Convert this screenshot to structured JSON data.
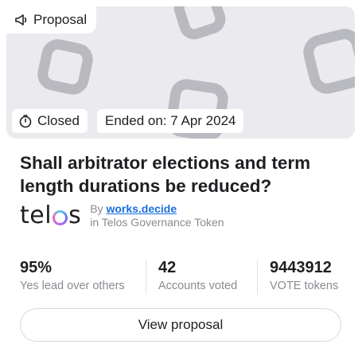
{
  "banner": {
    "type_label": "Proposal",
    "type_icon": "megaphone-icon",
    "status_label": "Closed",
    "status_icon": "stopwatch-icon",
    "ended_label": "Ended on: 7 Apr 2024",
    "background_color": "#ebebef",
    "pattern_color": "#b9b9c0"
  },
  "proposal": {
    "title": "Shall arbitrator elections and term length durations be reduced?"
  },
  "author": {
    "logo_prefix": "tel",
    "logo_suffix": "s",
    "by_prefix": "By",
    "by_name": "works.decide",
    "token_line": "in Telos Governance Token",
    "link_color": "#1a6fde"
  },
  "stats": [
    {
      "value": "95%",
      "label": "Yes lead over others"
    },
    {
      "value": "42",
      "label": "Accounts voted"
    },
    {
      "value": "9443912",
      "label": "VOTE tokens"
    }
  ],
  "actions": {
    "view_label": "View proposal"
  }
}
